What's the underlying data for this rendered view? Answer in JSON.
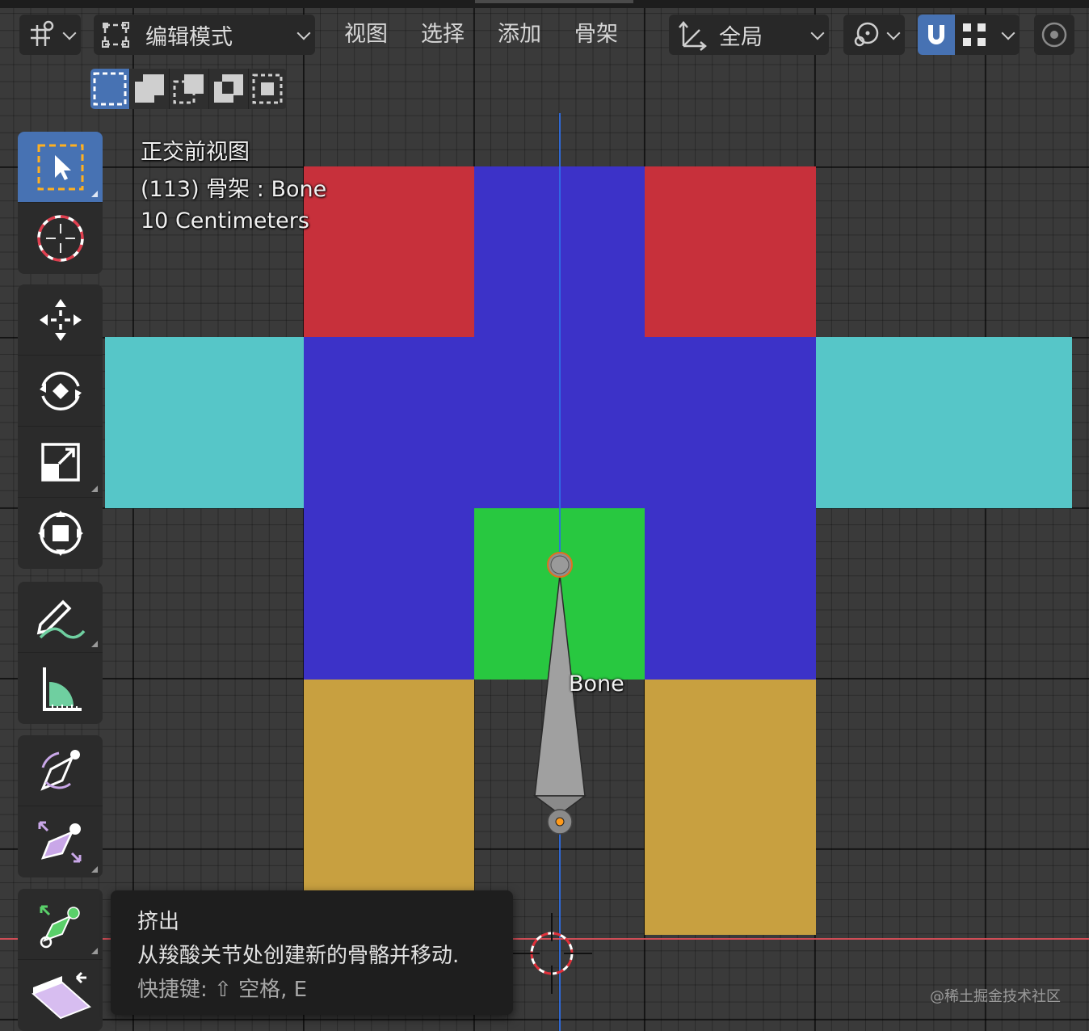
{
  "header": {
    "editor_type_icon": "armature-pose-icon",
    "mode": {
      "icon": "edit-mode-icon",
      "label": "编辑模式"
    },
    "menus": [
      "视图",
      "选择",
      "添加",
      "骨架"
    ],
    "transform_orientation": {
      "icon": "orientation-axes-icon",
      "label": "全局"
    },
    "pivot_icon": "pivot-point-icon",
    "snap_icon": "magnet-icon",
    "snap_enabled": true,
    "snap_target_icon": "snap-grid-icon",
    "proportional_icon": "proportional-edit-icon"
  },
  "select_modes": [
    "select-new-icon",
    "select-extend-icon",
    "select-subtract-icon",
    "select-invert-icon",
    "select-intersect-icon"
  ],
  "toolbar": {
    "tools": [
      {
        "name": "select-box",
        "icon": "select-box-icon",
        "active": true
      },
      {
        "name": "cursor",
        "icon": "cursor-icon"
      },
      {
        "name": "move",
        "icon": "move-icon"
      },
      {
        "name": "rotate",
        "icon": "rotate-icon"
      },
      {
        "name": "scale",
        "icon": "scale-icon"
      },
      {
        "name": "transform",
        "icon": "transform-icon"
      },
      {
        "name": "annotate",
        "icon": "annotate-icon"
      },
      {
        "name": "measure",
        "icon": "measure-icon"
      },
      {
        "name": "roll",
        "icon": "bone-roll-icon"
      },
      {
        "name": "bone-size",
        "icon": "bone-size-icon"
      },
      {
        "name": "extrude",
        "icon": "extrude-icon"
      },
      {
        "name": "bone-envelope",
        "icon": "bone-envelope-icon"
      }
    ]
  },
  "viewport": {
    "view_name": "正交前视图",
    "object_info": "(113) 骨架 : Bone",
    "grid_scale": "10 Centimeters",
    "bone_label": "Bone",
    "colors": {
      "head_blocks": "#c7303b",
      "body": "#3c32c8",
      "arms": "#56c6c8",
      "core": "#28c840",
      "legs": "#c8a040",
      "axis_blue": "#2e6ee6",
      "axis_red": "#e0505a"
    }
  },
  "tooltip": {
    "title": "挤出",
    "description": "从羧酸关节处创建新的骨骼并移动.",
    "shortcut": "快捷键: ⇧ 空格, E"
  },
  "watermark": "@稀土掘金技术社区"
}
